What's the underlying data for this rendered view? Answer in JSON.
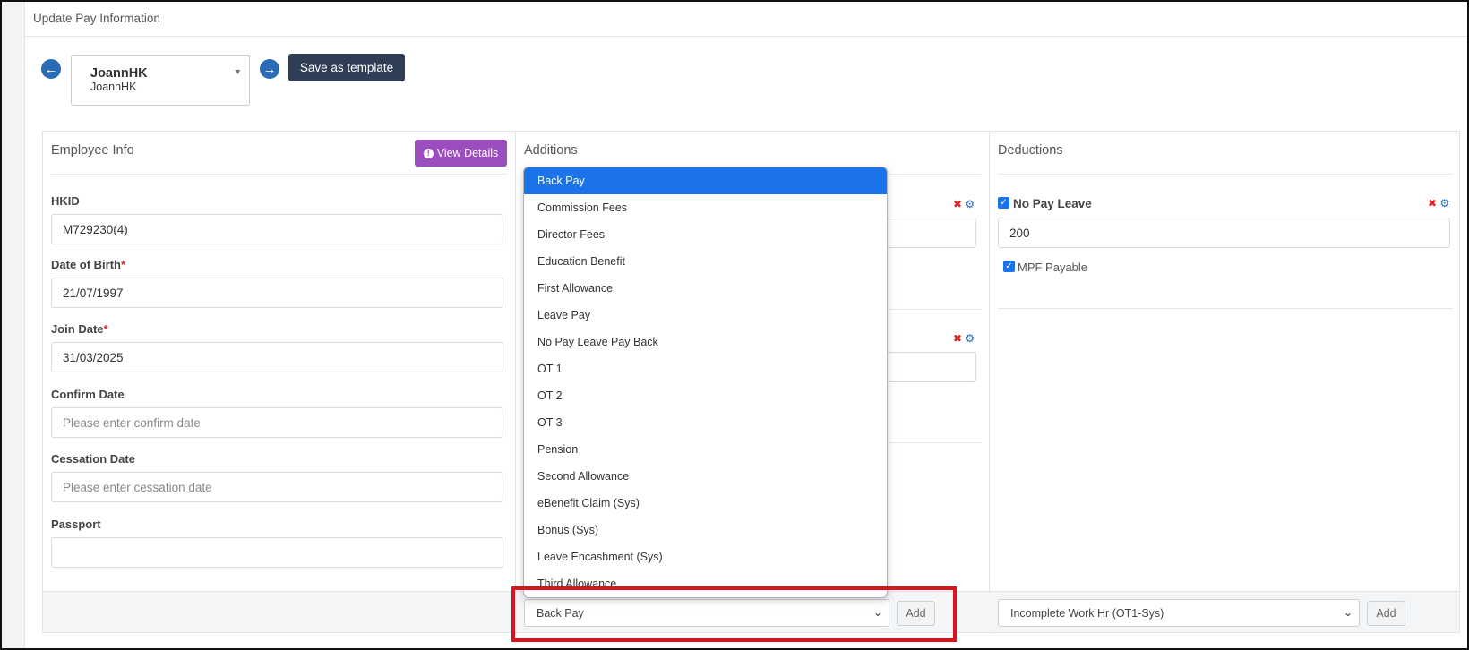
{
  "header": {
    "title": "Update Pay Information"
  },
  "employee_picker": {
    "name": "JoannHK",
    "sub": "JoannHK",
    "prev_icon": "arrow-left-circle-icon",
    "next_icon": "arrow-right-circle-icon"
  },
  "toolbar": {
    "save_template_label": "Save as template"
  },
  "employee_info": {
    "title": "Employee Info",
    "view_details_label": "View Details",
    "fields": [
      {
        "label": "HKID",
        "required": false,
        "value": "M729230(4)",
        "placeholder": ""
      },
      {
        "label": "Date of Birth",
        "required": true,
        "value": "21/07/1997",
        "placeholder": ""
      },
      {
        "label": "Join Date",
        "required": true,
        "value": "31/03/2025",
        "placeholder": ""
      },
      {
        "label": "Confirm Date",
        "required": false,
        "value": "",
        "placeholder": "Please enter confirm date"
      },
      {
        "label": "Cessation Date",
        "required": false,
        "value": "",
        "placeholder": "Please enter cessation date"
      },
      {
        "label": "Passport",
        "required": false,
        "value": "",
        "placeholder": ""
      }
    ],
    "required_mark": "*"
  },
  "additions": {
    "title": "Additions",
    "select_value": "Back Pay",
    "add_label": "Add",
    "dropdown_options": [
      "Back Pay",
      "Commission Fees",
      "Director Fees",
      "Education Benefit",
      "First Allowance",
      "Leave Pay",
      "No Pay Leave Pay Back",
      "OT 1",
      "OT 2",
      "OT 3",
      "Pension",
      "Second Allowance",
      "eBenefit Claim (Sys)",
      "Bonus (Sys)",
      "Leave Encashment (Sys)",
      "Third Allowance"
    ],
    "selected_option": "Back Pay"
  },
  "deductions": {
    "title": "Deductions",
    "item_label": "No Pay Leave",
    "item_checked": true,
    "item_value": "200",
    "mpf_label": "MPF Payable",
    "mpf_checked": true,
    "select_value": "Incomplete Work Hr (OT1-Sys)",
    "add_label": "Add"
  },
  "colors": {
    "primary": "#1a73e8",
    "dark_button": "#2f3e55",
    "view_details": "#9b4fbf",
    "delete": "#e02424",
    "highlight": "#d8151b"
  }
}
